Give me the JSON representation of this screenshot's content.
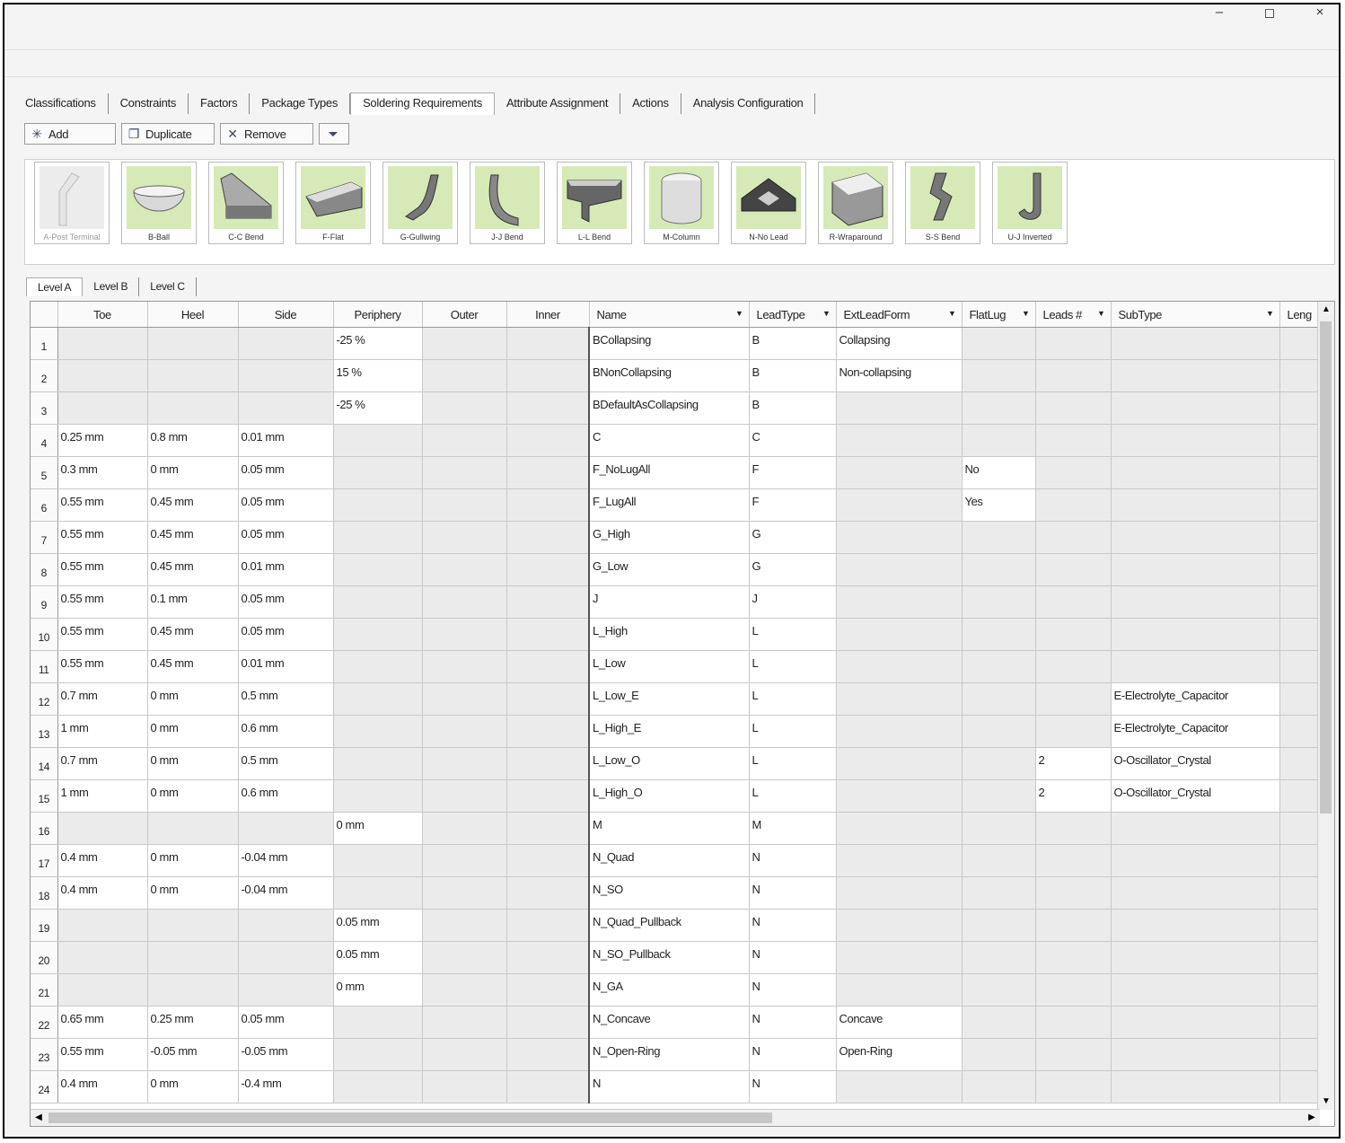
{
  "window": {
    "minimize_glyph": "–",
    "maximize_glyph": "◻",
    "close_glyph": "×"
  },
  "tabs": [
    "Classifications",
    "Constraints",
    "Factors",
    "Package Types",
    "Soldering Requirements",
    "Attribute Assignment",
    "Actions",
    "Analysis Configuration"
  ],
  "active_tab": "Soldering Requirements",
  "toolbar": {
    "add": "Add",
    "duplicate": "Duplicate",
    "remove": "Remove",
    "add_icon": "sparkle-icon",
    "duplicate_icon": "copy-icon",
    "remove_icon": "remove-icon",
    "filter_icon": "filter-icon"
  },
  "gallery": [
    {
      "label": "A-Post Terminal",
      "enabled": false
    },
    {
      "label": "B-Ball",
      "enabled": true
    },
    {
      "label": "C-C Bend",
      "enabled": true
    },
    {
      "label": "F-Flat",
      "enabled": true
    },
    {
      "label": "G-Gullwing",
      "enabled": true
    },
    {
      "label": "J-J Bend",
      "enabled": true
    },
    {
      "label": "L-L Bend",
      "enabled": true
    },
    {
      "label": "M-Column",
      "enabled": true
    },
    {
      "label": "N-No Lead",
      "enabled": true
    },
    {
      "label": "R-Wraparound",
      "enabled": true
    },
    {
      "label": "S-S Bend",
      "enabled": true
    },
    {
      "label": "U-J Inverted",
      "enabled": true
    }
  ],
  "level_tabs": [
    "Level A",
    "Level B",
    "Level C"
  ],
  "active_level": "Level A",
  "columns": [
    "Toe",
    "Heel",
    "Side",
    "Periphery",
    "Outer",
    "Inner",
    "Name",
    "LeadType",
    "ExtLeadForm",
    "FlatLug",
    "Leads #",
    "SubType",
    "Leng"
  ],
  "dropdown_glyph": "▼",
  "rows": [
    [
      "",
      "",
      "",
      "-25 %",
      "",
      "",
      "BCollapsing",
      "B",
      "Collapsing",
      "",
      "",
      ""
    ],
    [
      "",
      "",
      "",
      "15 %",
      "",
      "",
      "BNonCollapsing",
      "B",
      "Non-collapsing",
      "",
      "",
      ""
    ],
    [
      "",
      "",
      "",
      "-25 %",
      "",
      "",
      "BDefaultAsCollapsing",
      "B",
      "",
      "",
      "",
      ""
    ],
    [
      "0.25 mm",
      "0.8 mm",
      "0.01 mm",
      "",
      "",
      "",
      "C",
      "C",
      "",
      "",
      "",
      ""
    ],
    [
      "0.3 mm",
      "0 mm",
      "0.05 mm",
      "",
      "",
      "",
      "F_NoLugAll",
      "F",
      "",
      "No",
      "",
      ""
    ],
    [
      "0.55 mm",
      "0.45 mm",
      "0.05 mm",
      "",
      "",
      "",
      "F_LugAll",
      "F",
      "",
      "Yes",
      "",
      ""
    ],
    [
      "0.55 mm",
      "0.45 mm",
      "0.05 mm",
      "",
      "",
      "",
      "G_High",
      "G",
      "",
      "",
      "",
      ""
    ],
    [
      "0.55 mm",
      "0.45 mm",
      "0.01 mm",
      "",
      "",
      "",
      "G_Low",
      "G",
      "",
      "",
      "",
      ""
    ],
    [
      "0.55 mm",
      "0.1 mm",
      "0.05 mm",
      "",
      "",
      "",
      "J",
      "J",
      "",
      "",
      "",
      ""
    ],
    [
      "0.55 mm",
      "0.45 mm",
      "0.05 mm",
      "",
      "",
      "",
      "L_High",
      "L",
      "",
      "",
      "",
      ""
    ],
    [
      "0.55 mm",
      "0.45 mm",
      "0.01 mm",
      "",
      "",
      "",
      "L_Low",
      "L",
      "",
      "",
      "",
      ""
    ],
    [
      "0.7 mm",
      "0 mm",
      "0.5 mm",
      "",
      "",
      "",
      "L_Low_E",
      "L",
      "",
      "",
      "",
      "E-Electrolyte_Capacitor"
    ],
    [
      "1 mm",
      "0 mm",
      "0.6 mm",
      "",
      "",
      "",
      "L_High_E",
      "L",
      "",
      "",
      "",
      "E-Electrolyte_Capacitor"
    ],
    [
      "0.7 mm",
      "0 mm",
      "0.5 mm",
      "",
      "",
      "",
      "L_Low_O",
      "L",
      "",
      "",
      "2",
      "O-Oscillator_Crystal"
    ],
    [
      "1 mm",
      "0 mm",
      "0.6 mm",
      "",
      "",
      "",
      "L_High_O",
      "L",
      "",
      "",
      "2",
      "O-Oscillator_Crystal"
    ],
    [
      "",
      "",
      "",
      "0 mm",
      "",
      "",
      "M",
      "M",
      "",
      "",
      "",
      ""
    ],
    [
      "0.4 mm",
      "0 mm",
      "-0.04 mm",
      "",
      "",
      "",
      "N_Quad",
      "N",
      "",
      "",
      "",
      ""
    ],
    [
      "0.4 mm",
      "0 mm",
      "-0.04 mm",
      "",
      "",
      "",
      "N_SO",
      "N",
      "",
      "",
      "",
      ""
    ],
    [
      "",
      "",
      "",
      "0.05 mm",
      "",
      "",
      "N_Quad_Pullback",
      "N",
      "",
      "",
      "",
      ""
    ],
    [
      "",
      "",
      "",
      "0.05 mm",
      "",
      "",
      "N_SO_Pullback",
      "N",
      "",
      "",
      "",
      ""
    ],
    [
      "",
      "",
      "",
      "0 mm",
      "",
      "",
      "N_GA",
      "N",
      "",
      "",
      "",
      ""
    ],
    [
      "0.65 mm",
      "0.25 mm",
      "0.05 mm",
      "",
      "",
      "",
      "N_Concave",
      "N",
      "Concave",
      "",
      "",
      ""
    ],
    [
      "0.55 mm",
      "-0.05 mm",
      "-0.05 mm",
      "",
      "",
      "",
      "N_Open-Ring",
      "N",
      "Open-Ring",
      "",
      "",
      ""
    ],
    [
      "0.4 mm",
      "0 mm",
      "-0.4 mm",
      "",
      "",
      "",
      "N",
      "N",
      "",
      "",
      "",
      ""
    ]
  ],
  "row_numbers": [
    "1",
    "2",
    "3",
    "4",
    "5",
    "6",
    "7",
    "8",
    "9",
    "10",
    "11",
    "12",
    "13",
    "14",
    "15",
    "16",
    "17",
    "18",
    "19",
    "20",
    "21",
    "22",
    "23",
    "24"
  ]
}
